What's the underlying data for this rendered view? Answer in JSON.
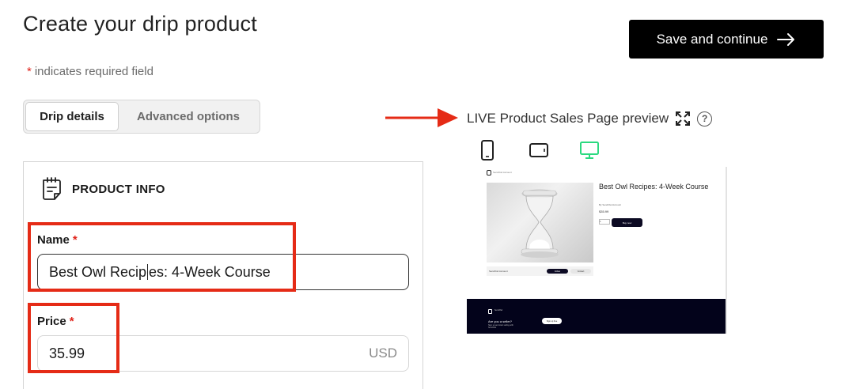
{
  "header": {
    "title": "Create your drip product",
    "required_star": "*",
    "required_note": "indicates required field",
    "save_label": "Save and continue"
  },
  "tabs": [
    {
      "label": "Drip details",
      "active": true
    },
    {
      "label": "Advanced options",
      "active": false
    }
  ],
  "product_info": {
    "section_title": "PRODUCT INFO",
    "name_label": "Name",
    "name_required": "*",
    "name_value_before_caret": "Best Owl Recip",
    "name_value_after_caret": "es: 4-Week Course",
    "price_label": "Price",
    "price_required": "*",
    "price_value": "35.99",
    "price_unit": "USD"
  },
  "preview": {
    "title": "LIVE Product Sales Page preview",
    "help": "?",
    "devices": [
      "mobile-icon",
      "tablet-icon",
      "desktop-icon"
    ],
    "active_device": "desktop",
    "active_color": "#2bd97f",
    "mini": {
      "logo_text": "SendOwl Account",
      "product_title": "Best Owl Recipes: 4-Week Course",
      "by_line": "By SendOwl Account",
      "price": "$35.99",
      "qty": "1",
      "buy_label": "Buy now",
      "bar_text": "SendOwl Account",
      "bar_btn1": "Follow",
      "bar_btn2": "Contact",
      "footer_logo_text": "SendOwl",
      "seller_heading": "Are you a seller?",
      "seller_sub": "Sign up and start selling with SendOwl",
      "signup_label": "Sign up free"
    }
  },
  "colors": {
    "highlight": "#e52b16",
    "required": "#e0241b",
    "button_bg": "#000000"
  }
}
